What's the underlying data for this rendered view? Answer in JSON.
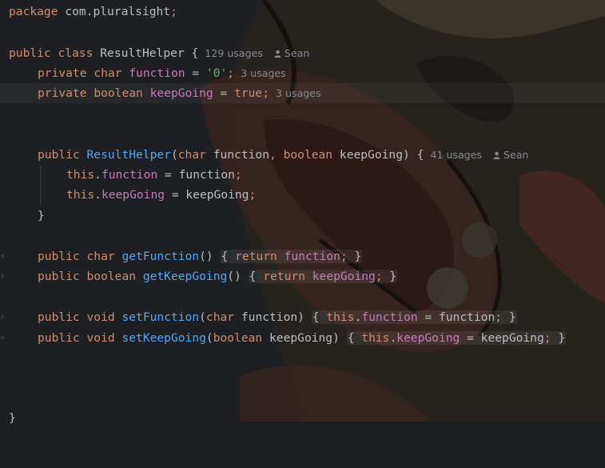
{
  "code": {
    "package_kw": "package",
    "package_name": " com.pluralsight",
    "semicolon": ";",
    "public": "public",
    "class_kw": "class",
    "class_name": "ResultHelper",
    "open_brace": "{",
    "close_brace": "}",
    "private": "private",
    "char": "char",
    "boolean": "boolean",
    "void": "void",
    "this": "this",
    "return": "return",
    "field_function": "function",
    "field_keepGoing": "keepGoing",
    "eq": " = ",
    "char_literal": "'0'",
    "true_literal": "true",
    "ctor_name": "ResultHelper",
    "param_function": "function",
    "param_keepGoing": "keepGoing",
    "getFunction": "getFunction",
    "getKeepGoing": "getKeepGoing",
    "setFunction": "setFunction",
    "setKeepGoing": "setKeepGoing"
  },
  "hints": {
    "class_usages": "129 usages",
    "class_author": "Sean",
    "function_usages": "3 usages",
    "keepgoing_usages": "3 usages",
    "ctor_usages": "41 usages",
    "ctor_author": "Sean"
  }
}
